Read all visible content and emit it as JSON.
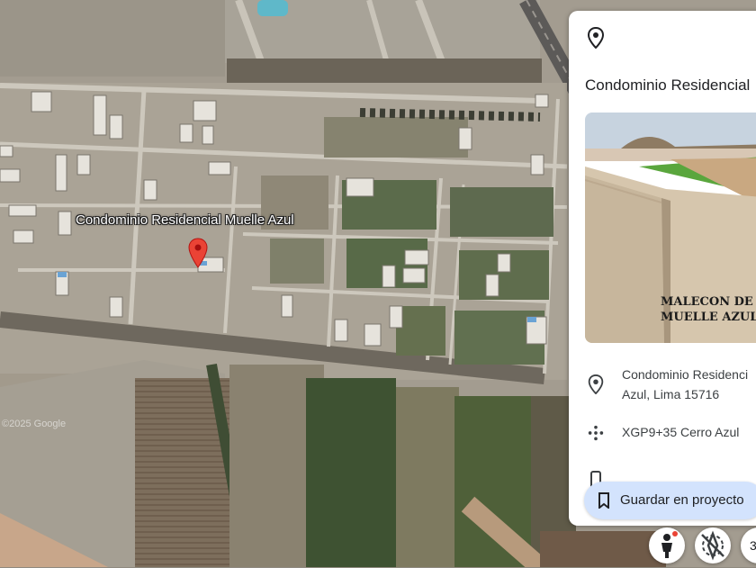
{
  "map": {
    "place_label": "Condominio Residencial Muelle Azul",
    "copyright": "©2025 Google",
    "pin_icon": "map-pin-icon"
  },
  "panel": {
    "top_icon": "location-pin-icon",
    "title": "Condominio Residencial",
    "photo_caption_line1": "MALECON DE",
    "photo_caption_line2": "MUELLE AZUL",
    "address_icon": "location-pin-icon",
    "address_line1": "Condominio Residenci",
    "address_line2": "Azul, Lima 15716",
    "pluscode_icon": "plus-code-icon",
    "pluscode": "XGP9+35 Cerro Azul",
    "save_icon": "bookmark-icon",
    "save_label": "Guardar en proyecto"
  },
  "controls": {
    "pegman_icon": "pegman-icon",
    "compass_icon": "compass-off-icon",
    "partial_label": "3"
  }
}
